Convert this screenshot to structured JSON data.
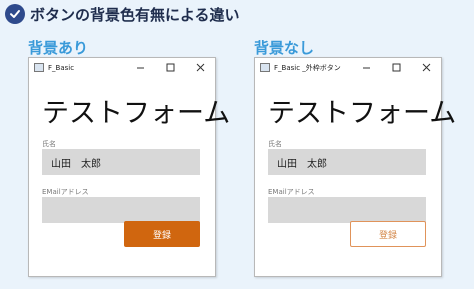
{
  "heading": {
    "text": "ボタンの背景色有無による違い",
    "icon": "check-icon"
  },
  "left": {
    "section_label": "背景あり",
    "window_title": "F_Basic",
    "form_title": "テストフォーム",
    "name_label": "氏名",
    "name_value": "山田　太郎",
    "email_label": "EMailアドレス",
    "email_value": "",
    "button_label": "登録"
  },
  "right": {
    "section_label": "背景なし",
    "window_title": "F_Basic _外枠ボタン",
    "form_title": "テストフォーム",
    "name_label": "氏名",
    "name_value": "山田　太郎",
    "email_label": "EMailアドレス",
    "email_value": "",
    "button_label": "登録"
  },
  "colors": {
    "accent_orange": "#d0660f",
    "section_blue": "#3a9ad9",
    "page_background": "#eaf3fb"
  }
}
